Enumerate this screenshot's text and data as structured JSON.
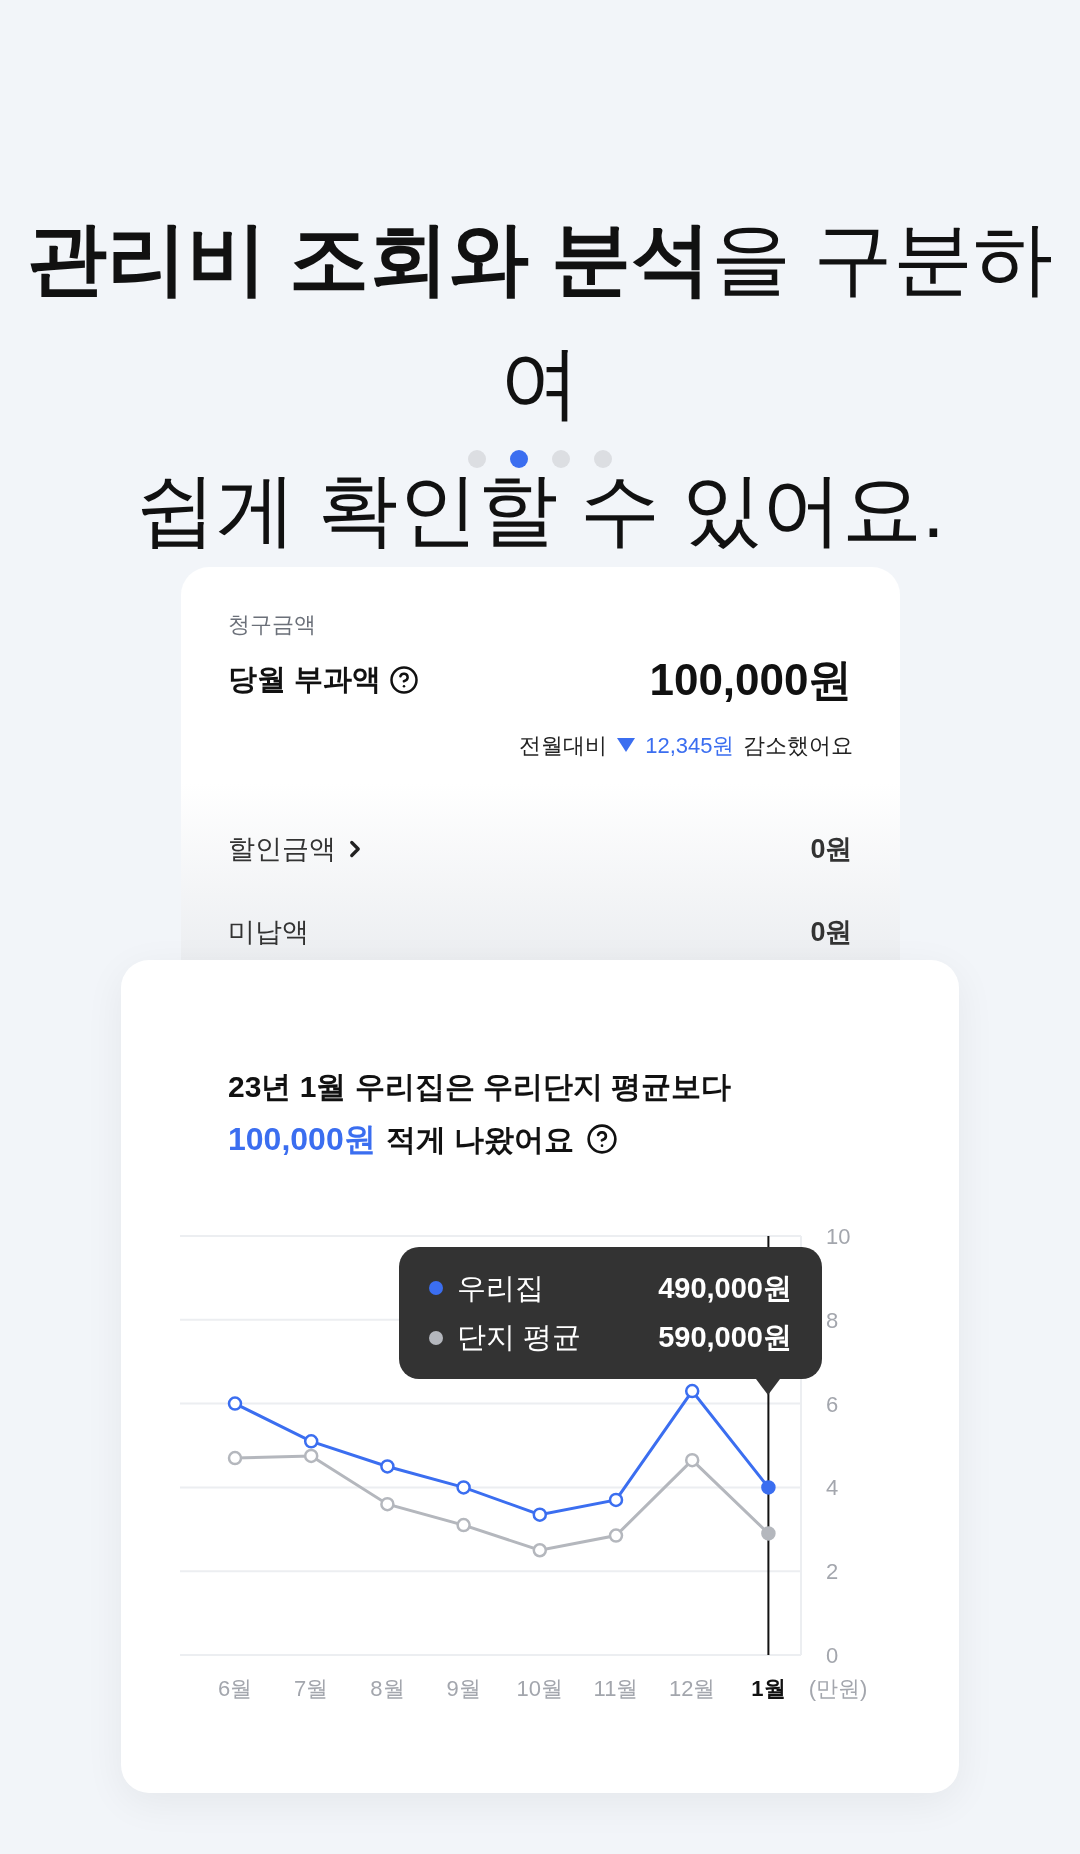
{
  "headline": {
    "lines": [
      "**관리비 조회와 분석**을 구분하여",
      "쉽게 확인할 수 있어요."
    ]
  },
  "page_indicator": [
    {
      "selected": false
    },
    {
      "selected": true
    },
    {
      "selected": false
    },
    {
      "selected": false
    }
  ],
  "billing_card": {
    "section_label": "청구금액",
    "current_charge": {
      "label": "당월 부과액",
      "amount": "100,000원"
    },
    "comparison": {
      "prefix": "전월대비",
      "decrease": true,
      "amount": "12,345원",
      "suffix": "감소했어요"
    },
    "rows": [
      {
        "label": "할인금액",
        "value": "0원",
        "link": true
      },
      {
        "label": "미납액",
        "value": "0원",
        "link": false
      }
    ]
  },
  "analysis_card": {
    "title": "23년 1월 우리집은 우리단지 평균보다",
    "highlight": "100,000원",
    "title_end": "적게 나왔어요",
    "chart_data": {
      "type": "line",
      "categories": [
        "6월",
        "7월",
        "8월",
        "9월",
        "10월",
        "11월",
        "12월",
        "1월"
      ],
      "series": [
        {
          "name": "우리집",
          "color": "#3b6ef0",
          "marker": "circle",
          "values": [
            6.0,
            5.1,
            4.5,
            4.0,
            3.35,
            3.7,
            6.3,
            4.0
          ]
        },
        {
          "name": "단지 평균",
          "color": "#b4b7bd",
          "marker": "circle",
          "values": [
            4.7,
            4.75,
            3.6,
            3.1,
            2.5,
            2.85,
            4.65,
            2.9
          ]
        }
      ],
      "ylim": [
        0,
        10
      ],
      "yticks": [
        0,
        2,
        4,
        6,
        8,
        10
      ],
      "ylabel": "(만원)",
      "grid": true,
      "legend": true,
      "ref_lines": [
        {
          "axis": "x",
          "value": "1월",
          "color": "#111111"
        }
      ]
    },
    "tooltip": {
      "values": [
        "490,000원",
        "590,000원"
      ]
    }
  }
}
